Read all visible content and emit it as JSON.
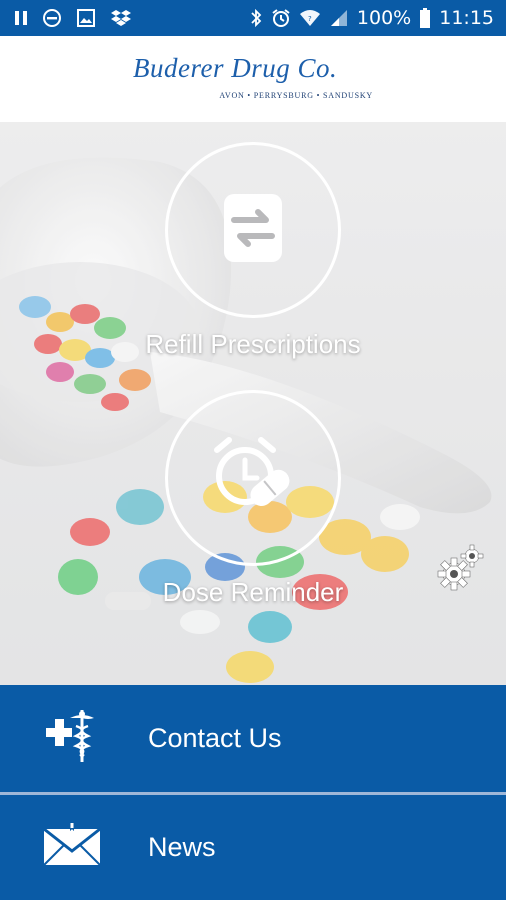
{
  "status_bar": {
    "battery": "100%",
    "time": "11:15",
    "icons": [
      "pause-icon",
      "do-not-disturb-icon",
      "image-icon",
      "dropbox-icon",
      "bluetooth-icon",
      "alarm-icon",
      "wifi-icon",
      "signal-icon",
      "battery-icon"
    ]
  },
  "header": {
    "logo_text": "Buderer Drug Co.",
    "logo_subtext": "AVON • PERRYSBURG • SANDUSKY"
  },
  "hero": {
    "refill_label": "Refill Prescriptions",
    "dose_label": "Dose Reminder",
    "refill_icon": "refill-arrows-icon",
    "dose_icon": "alarm-pill-icon",
    "settings_icon": "gears-icon"
  },
  "menu": {
    "contact_label": "Contact Us",
    "contact_icon": "caduceus-cross-icon",
    "news_label": "News",
    "news_icon": "envelope-icon"
  },
  "colors": {
    "brand_blue": "#0a5ba6",
    "divider": "#9fb7d8"
  }
}
